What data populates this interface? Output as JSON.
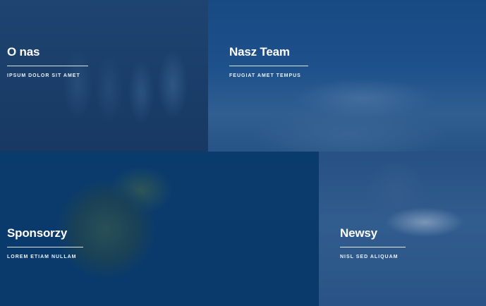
{
  "tiles": [
    {
      "title": "O nas",
      "subtitle": "IPSUM DOLOR SIT AMET"
    },
    {
      "title": "Nasz Team",
      "subtitle": "FEUGIAT AMET TEMPUS"
    },
    {
      "title": "Sponsorzy",
      "subtitle": "LOREM ETIAM NULLAM"
    },
    {
      "title": "Newsy",
      "subtitle": "NISL SED ALIQUAM"
    }
  ],
  "colors": {
    "overlay": "#0b3a6b",
    "text": "#ffffff"
  }
}
